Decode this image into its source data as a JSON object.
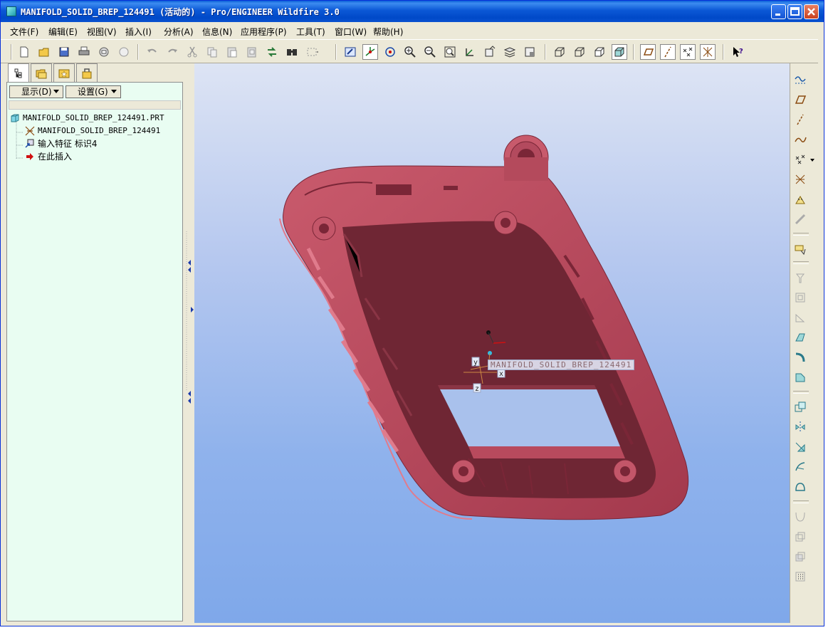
{
  "window": {
    "title": "MANIFOLD_SOLID_BREP_124491 (活动的) - Pro/ENGINEER Wildfire 3.0",
    "controls": [
      "minimize",
      "maximize",
      "close"
    ]
  },
  "menu": {
    "items": [
      "文件(F)",
      "编辑(E)",
      "视图(V)",
      "插入(I)",
      "分析(A)",
      "信息(N)",
      "应用程序(P)",
      "工具(T)",
      "窗口(W)",
      "帮助(H)"
    ]
  },
  "toolbar": {
    "icons": [
      "new-icon",
      "open-icon",
      "save-icon",
      "print-icon",
      "send-mail-icon",
      "send-link-icon",
      "undo-icon",
      "redo-icon",
      "cut-icon",
      "copy-icon",
      "paste-icon",
      "paste-special-icon",
      "regenerate-icon",
      "find-icon",
      "select-box-icon",
      "repaint-icon",
      "spin-center-icon",
      "orient-mode-icon",
      "zoom-in-icon",
      "zoom-out-icon",
      "refit-icon",
      "reorient-icon",
      "saved-views-icon",
      "layers-icon",
      "view-manager-icon",
      "wireframe-icon",
      "hidden-line-icon",
      "no-hidden-icon",
      "shading-icon",
      "datum-planes-icon",
      "datum-axes-icon",
      "datum-points-icon",
      "coordinate-systems-icon",
      "context-help-icon"
    ]
  },
  "navigator": {
    "tabs": [
      "model-tree-tab",
      "folder-browser-tab",
      "favorites-tab",
      "connections-tab"
    ],
    "show_label": "显示(D)",
    "settings_label": "设置(G)",
    "tree": [
      {
        "label": "MANIFOLD_SOLID_BREP_124491.PRT",
        "icon": "part-icon"
      },
      {
        "label": "MANIFOLD_SOLID_BREP_124491",
        "icon": "csys-icon"
      },
      {
        "label": "输入特征 标识4",
        "icon": "import-feature-icon"
      },
      {
        "label": "在此插入",
        "icon": "insert-here-arrow-icon"
      }
    ]
  },
  "viewport": {
    "model_label": "MANIFOLD_SOLID_BREP_124491",
    "axes": {
      "x": "x",
      "y": "y",
      "z": "z"
    },
    "model_color": "#b44a5c",
    "background_top": "#dde4f4",
    "background_bottom": "#7fa8ea"
  },
  "right_toolbar": {
    "icons": [
      "sketched-curve-icon",
      "datum-plane-icon",
      "datum-axis-icon",
      "datum-curve-icon",
      "datum-point-icon",
      "datum-csys-icon",
      "analysis-feature-icon",
      "datum-chain-icon",
      "annotation-icon",
      "hole-icon",
      "shell-icon",
      "rib-icon",
      "draft-icon",
      "round-icon",
      "chamfer-icon",
      "copy-icon",
      "mirror-icon",
      "merge-icon",
      "trim-icon",
      "extend-icon",
      "offset-icon",
      "thicken-icon",
      "solidify-icon",
      "pattern-icon"
    ]
  }
}
